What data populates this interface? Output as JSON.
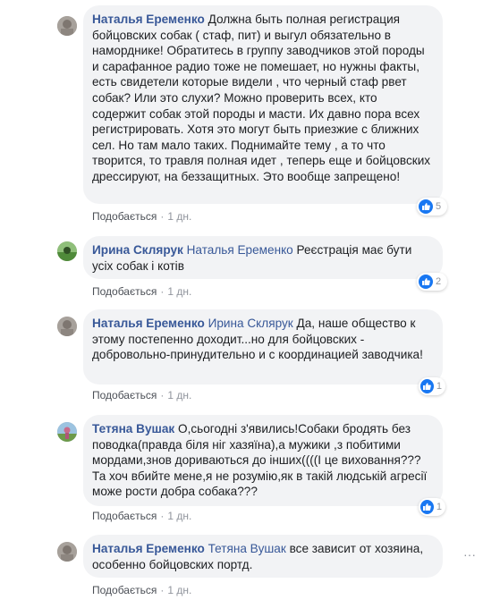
{
  "comments": [
    {
      "author": "Наталья Еременко",
      "mention": "",
      "text": "Должна быть полная регистрация бойцовских собак ( стаф, пит) и выгул обязательно в наморднике! Обратитесь в группу заводчиков этой породы и сарафанное радио тоже не помешает, но нужны факты, есть свидетели которые видели , что черный стаф рвет собак? Или это слухи? Можно проверить всех, кто содержит собак этой породы и масти. Их давно пора всех регистрировать. Хотя это могут быть приезжие с ближних сел. Но там мало таких. Поднимайте тему , а то что творится, то травля полная идет , теперь еще и бойцовских дрессируют, на беззащитных. Это вообще запрещено!",
      "like_label": "Подобається",
      "time": "1 дн.",
      "reaction_count": "5"
    },
    {
      "author": "Ирина Склярук",
      "mention": "Наталья Еременко",
      "text": "Реєстрація має бути усіх собак і котів",
      "like_label": "Подобається",
      "time": "1 дн.",
      "reaction_count": "2"
    },
    {
      "author": "Наталья Еременко",
      "mention": "Ирина Склярук",
      "text": "Да, наше общество к этому постепенно доходит...но для бойцовских - добровольно-принудительно и с координацией заводчика!",
      "like_label": "Подобається",
      "time": "1 дн.",
      "reaction_count": "1"
    },
    {
      "author": "Тетяна Вушак",
      "mention": "",
      "text": "О,сьогодні з'явились!Собаки бродять без поводка(правда біля ніг хазяїна),а мужики ,з побитими мордами,знов дориваються до інших((((І це виховання??? Та хоч вбийте мене,я не розумію,як в такій людській агресії може рости добра собака???",
      "like_label": "Подобається",
      "time": "1 дн.",
      "reaction_count": "1"
    },
    {
      "author": "Наталья Еременко",
      "mention": "Тетяна Вушак",
      "text": "все зависит от хозяина, особенно бойцовских портд.",
      "like_label": "Подобається",
      "time": "1 дн.",
      "reaction_count": ""
    }
  ],
  "icons": {
    "like_reaction": "thumbs-up-icon",
    "more": "more-options-icon"
  },
  "colors": {
    "author": "#385898",
    "bubble": "#f2f3f5",
    "like_badge": "#1877f2",
    "meta": "#90949c"
  }
}
